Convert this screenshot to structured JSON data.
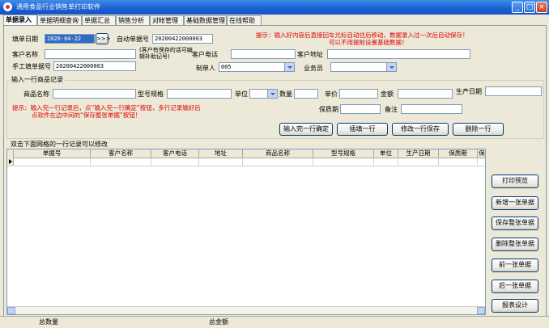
{
  "window": {
    "title": "通用食品行业销售单打印软件"
  },
  "tabs": [
    "单据录入",
    "单据明细查询",
    "单据汇总",
    "销售分析",
    "对帐管理",
    "基础数据管理",
    "在线帮助"
  ],
  "form": {
    "date_label": "填单日期",
    "date_value": "2020-04-22",
    "date_button": ">>>",
    "auto_no_label": "自动单据号",
    "auto_no_value": "20200422000003",
    "hint1": "提示：输入好内容后直接回车光标自动往后移动，数据录入过一次后自动保存！",
    "hint2": "可以不用提前设置基础数据！",
    "customer_label": "客户名称",
    "customer_note": "(客户有保存的话可编辑补助记号)",
    "phone_label": "客户电话",
    "address_label": "客户地址",
    "manual_no_label": "手工填单据号",
    "manual_no_value": "20200422000003",
    "maker_label": "制单人",
    "maker_value": "005",
    "clerk_label": "业务员",
    "clerk_value": ""
  },
  "item_group": {
    "title": "输入一行商品记录",
    "product_label": "商品名称",
    "model_label": "型号规格",
    "unit_label": "单位",
    "qty_label": "数量",
    "price_label": "单价",
    "amount_label": "金额",
    "prod_date_label": "生产日期",
    "shelf_label": "保质期",
    "remark_label": "备注",
    "hint1": "提示：输入完一行记录后，点“输入完一行确定”按钮，多行记录输好后",
    "hint2": "点软件左边中间的“保存整张单据”按钮！",
    "btn_confirm": "输入完一行确定",
    "btn_blank": "插填一行",
    "btn_modify": "修改一行保存",
    "btn_delete": "删除一行"
  },
  "grid": {
    "title": "双击下面网格的一行记录可以修改",
    "columns": [
      "单据号",
      "客户名称",
      "客户电话",
      "地址",
      "商品名称",
      "型号规格",
      "单位",
      "生产日期",
      "保质期"
    ]
  },
  "side_buttons": {
    "print": "打印预览",
    "new": "新增一张单据",
    "save": "保存整张单据",
    "delete": "删除整张单据",
    "prev": "前一张单据",
    "next": "后一张单据",
    "design": "报表设计"
  },
  "status": {
    "total_qty_label": "总数量",
    "total_amount_label": "总金额"
  }
}
